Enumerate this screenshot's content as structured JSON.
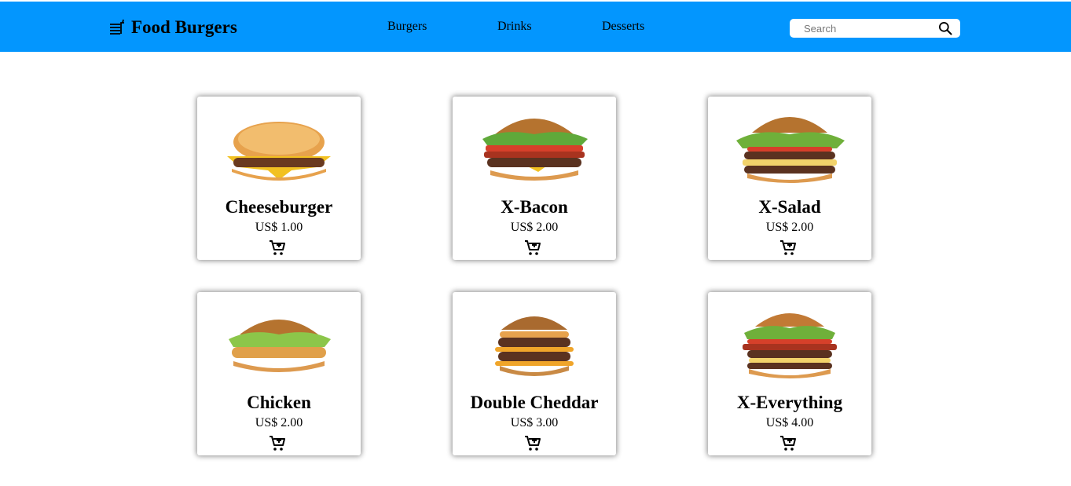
{
  "header": {
    "brand": "Food Burgers",
    "nav": [
      "Burgers",
      "Drinks",
      "Desserts"
    ],
    "search_placeholder": "Search"
  },
  "products": [
    {
      "name": "Cheeseburger",
      "price": "US$ 1.00"
    },
    {
      "name": "X-Bacon",
      "price": "US$ 2.00"
    },
    {
      "name": "X-Salad",
      "price": "US$ 2.00"
    },
    {
      "name": "Chicken",
      "price": "US$ 2.00"
    },
    {
      "name": "Double Cheddar",
      "price": "US$ 3.00"
    },
    {
      "name": "X-Everything",
      "price": "US$ 4.00"
    }
  ],
  "colors": {
    "header": "#0396fe",
    "background": "#ffffff"
  }
}
